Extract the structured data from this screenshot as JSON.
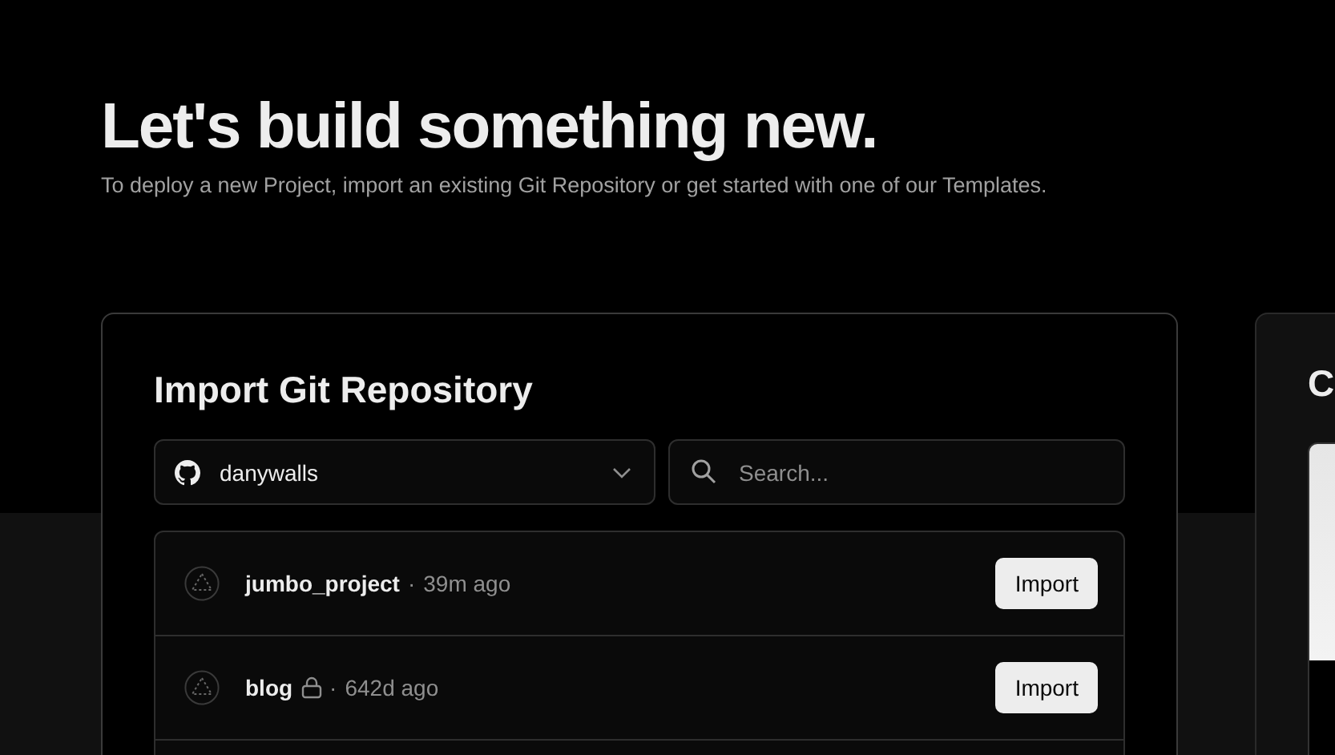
{
  "header": {
    "title": "Let's build something new.",
    "subtitle": "To deploy a new Project, import an existing Git Repository or get started with one of our Templates."
  },
  "import_card": {
    "title": "Import Git Repository",
    "account_select": {
      "value": "danywalls"
    },
    "search": {
      "placeholder": "Search..."
    },
    "repositories": [
      {
        "name": "jumbo_project",
        "private": false,
        "separator": "·",
        "time": "39m ago",
        "action": "Import"
      },
      {
        "name": "blog",
        "private": true,
        "separator": "·",
        "time": "642d ago",
        "action": "Import"
      }
    ]
  },
  "template_card": {
    "title": "C"
  }
}
